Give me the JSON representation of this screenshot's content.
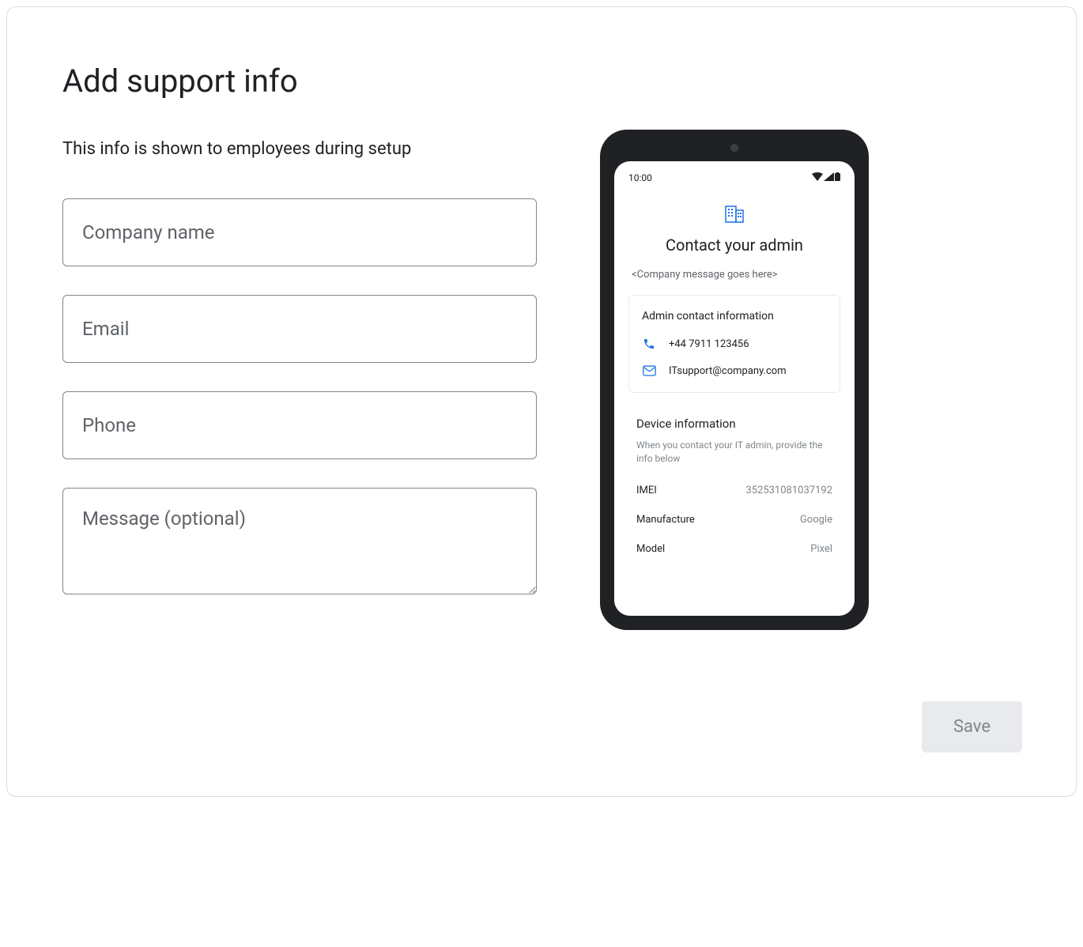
{
  "page": {
    "title": "Add support info",
    "subtitle": "This info is shown to employees during setup"
  },
  "form": {
    "company_placeholder": "Company name",
    "email_placeholder": "Email",
    "phone_placeholder": "Phone",
    "message_placeholder": "Message (optional)"
  },
  "phone_preview": {
    "status_time": "10:00",
    "title": "Contact your admin",
    "message_placeholder": "<Company message goes here>",
    "contact_card": {
      "title": "Admin contact information",
      "phone": "+44 7911 123456",
      "email": "ITsupport@company.com"
    },
    "device_info": {
      "title": "Device information",
      "subtitle": "When you contact your IT admin, provide the info below",
      "rows": [
        {
          "label": "IMEI",
          "value": "352531081037192"
        },
        {
          "label": "Manufacture",
          "value": "Google"
        },
        {
          "label": "Model",
          "value": "Pixel"
        }
      ]
    }
  },
  "actions": {
    "save_label": "Save"
  }
}
